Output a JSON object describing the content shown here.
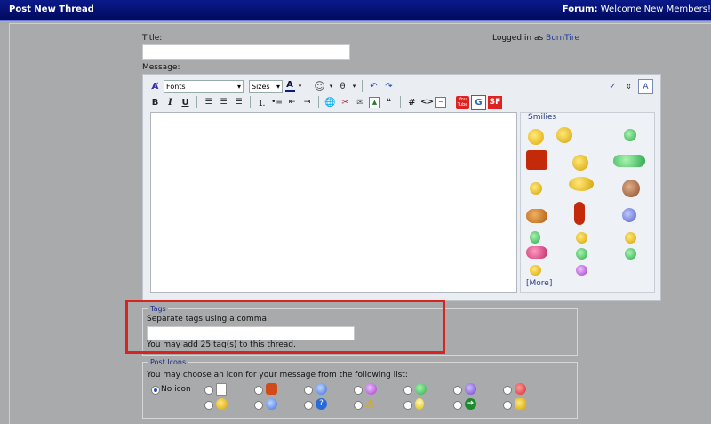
{
  "header": {
    "title": "Post New Thread",
    "forum_label": "Forum:",
    "forum_name": "Welcome New Members!"
  },
  "form": {
    "title_label": "Title:",
    "title_value": "",
    "logged_in_prefix": "Logged in as",
    "username": "BurnTire",
    "message_label": "Message:"
  },
  "toolbar": {
    "font_select": "Fonts",
    "size_select": "Sizes",
    "bold": "B",
    "italic": "I",
    "underline": "U",
    "hash": "#",
    "code": "<>",
    "youtube": "You Tube",
    "google": "G",
    "sf": "SF"
  },
  "smilies": {
    "title": "Smilies",
    "more": "[More]"
  },
  "tags": {
    "legend": "Tags",
    "help": "Separate tags using a comma.",
    "value": "",
    "limit": "You may add 25 tag(s) to this thread."
  },
  "post_icons": {
    "legend": "Post Icons",
    "prompt": "You may choose an icon for your message from the following list:",
    "no_icon": "No icon"
  },
  "colors": {
    "titlebar": "#0a1a8a",
    "highlight": "#d9231f",
    "link": "#1a3a9a"
  }
}
